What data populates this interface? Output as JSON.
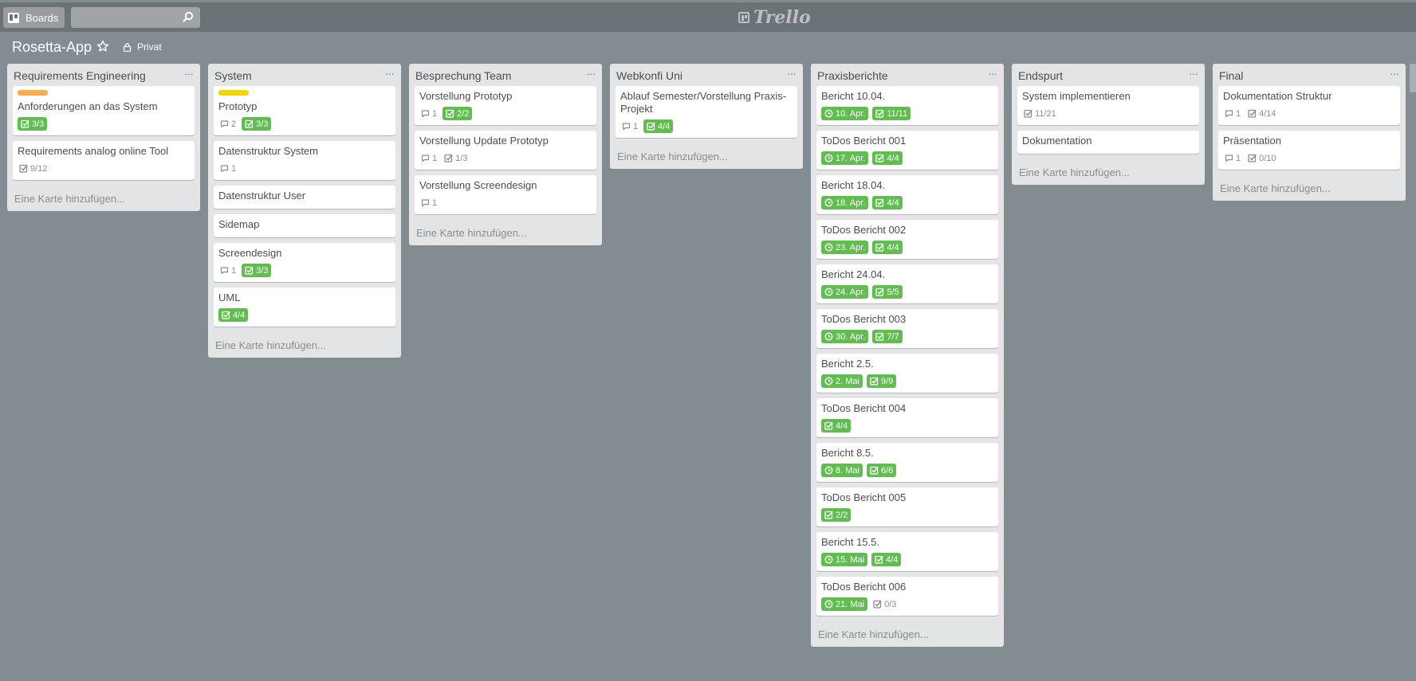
{
  "header": {
    "boards_label": "Boards",
    "search_value": "",
    "logo_text": "Trello"
  },
  "board": {
    "title": "Rosetta-App",
    "privacy": "Privat"
  },
  "add_card_label": "Eine Karte hinzufügen...",
  "colors": {
    "green_badge": "#61bd4f",
    "label_orange": "#ffab4a",
    "label_yellow": "#f2d600",
    "board_bg": "#838c91"
  },
  "lists": [
    {
      "title": "Requirements Engineering",
      "cards": [
        {
          "label": "orange",
          "title": "Anforderungen an das System",
          "checklist": "3/3",
          "checklist_done": true
        },
        {
          "title": "Requirements analog online Tool",
          "checklist": "9/12",
          "checklist_done": false
        }
      ]
    },
    {
      "title": "System",
      "cards": [
        {
          "label": "yellow",
          "title": "Prototyp",
          "comments": "2",
          "checklist": "3/3",
          "checklist_done": true
        },
        {
          "title": "Datenstruktur System",
          "comments": "1"
        },
        {
          "title": "Datenstruktur User"
        },
        {
          "title": "Sidemap"
        },
        {
          "title": "Screendesign",
          "comments": "1",
          "checklist": "3/3",
          "checklist_done": true
        },
        {
          "title": "UML",
          "checklist": "4/4",
          "checklist_done": true
        }
      ]
    },
    {
      "title": "Besprechung Team",
      "cards": [
        {
          "title": "Vorstellung Prototyp",
          "comments": "1",
          "checklist": "2/2",
          "checklist_done": true
        },
        {
          "title": "Vorstellung Update Prototyp",
          "comments": "1",
          "checklist": "1/3",
          "checklist_done": false
        },
        {
          "title": "Vorstellung Screendesign",
          "comments": "1"
        }
      ]
    },
    {
      "title": "Webkonfi Uni",
      "cards": [
        {
          "title": "Ablauf Semester/Vorstellung Praxis-Projekt",
          "comments": "1",
          "checklist": "4/4",
          "checklist_done": true
        }
      ]
    },
    {
      "title": "Praxisberichte",
      "cards": [
        {
          "title": "Bericht 10.04.",
          "due": "10. Apr.",
          "checklist": "11/11",
          "checklist_done": true
        },
        {
          "title": "ToDos Bericht 001",
          "due": "17. Apr.",
          "checklist": "4/4",
          "checklist_done": true
        },
        {
          "title": "Bericht 18.04.",
          "due": "18. Apr.",
          "checklist": "4/4",
          "checklist_done": true
        },
        {
          "title": "ToDos Bericht 002",
          "due": "23. Apr.",
          "checklist": "4/4",
          "checklist_done": true
        },
        {
          "title": "Bericht 24.04.",
          "due": "24. Apr.",
          "checklist": "5/5",
          "checklist_done": true
        },
        {
          "title": "ToDos Bericht 003",
          "due": "30. Apr.",
          "checklist": "7/7",
          "checklist_done": true
        },
        {
          "title": "Bericht 2.5.",
          "due": "2. Mai",
          "checklist": "9/9",
          "checklist_done": true
        },
        {
          "title": "ToDos Bericht 004",
          "checklist": "4/4",
          "checklist_done": true
        },
        {
          "title": "Bericht 8.5.",
          "due": "8. Mai",
          "checklist": "6/6",
          "checklist_done": true
        },
        {
          "title": "ToDos Bericht 005",
          "checklist": "2/2",
          "checklist_done": true
        },
        {
          "title": "Bericht 15.5.",
          "due": "15. Mai",
          "checklist": "4/4",
          "checklist_done": true
        },
        {
          "title": "ToDos Bericht 006",
          "due": "21. Mai",
          "checklist": "0/3",
          "checklist_done": false
        }
      ]
    },
    {
      "title": "Endspurt",
      "cards": [
        {
          "title": "System implementieren",
          "checklist": "11/21",
          "checklist_done": false
        },
        {
          "title": "Dokumentation"
        }
      ]
    },
    {
      "title": "Final",
      "cards": [
        {
          "title": "Dokumentation Struktur",
          "comments": "1",
          "checklist": "4/14",
          "checklist_done": false
        },
        {
          "title": "Präsentation",
          "comments": "1",
          "checklist": "0/10",
          "checklist_done": false
        }
      ]
    }
  ]
}
